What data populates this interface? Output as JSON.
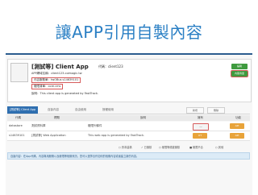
{
  "slide": {
    "title": "讓APP引用自製內容"
  },
  "app": {
    "title": "[測試等] Client App",
    "code": "代碼：client123",
    "info_lines": [
      "APP網域名稱：client123.coimagic.tw",
      "內容服務單：twOBus s14639101",
      "權限清單：core.cms",
      "說明：This client app is generated by FastTrack."
    ],
    "buttons": [
      "編輯",
      "內容清單"
    ]
  },
  "tabs": {
    "items": [
      "[測試等] Client App",
      "自製內容",
      "自由使用",
      "授權使用"
    ],
    "actions": [
      "新增",
      "刪除"
    ]
  },
  "table": {
    "headers": [
      "代碼",
      "標題",
      "說明",
      "擁有",
      "功能"
    ],
    "rows": [
      {
        "code": "datastore",
        "title": "測試資料庫",
        "desc": "權限列條件",
        "owner": "---",
        "action": "API"
      },
      {
        "code": "s14639101",
        "title": "[測試等] Web Application",
        "desc": "This web app is generated by FastTrack.",
        "owner": "OT",
        "action": "API"
      }
    ]
  },
  "legend": [
    "○ 資本建構",
    "✓ 已審核",
    "○ 權限等候被審核",
    "■ 權限不合",
    "○ 其他"
  ],
  "banner": "自製內容：在App代碼，內容專用服務以及權限等相關資訊，您可以選擇合作如何的相關內容或者建立新的內容。",
  "colors": {
    "accent_blue": "#2f6fb0",
    "btn_green": "#3f9b3f",
    "btn_orange": "#e8a33a",
    "slide_title": "#2a7fc4"
  }
}
